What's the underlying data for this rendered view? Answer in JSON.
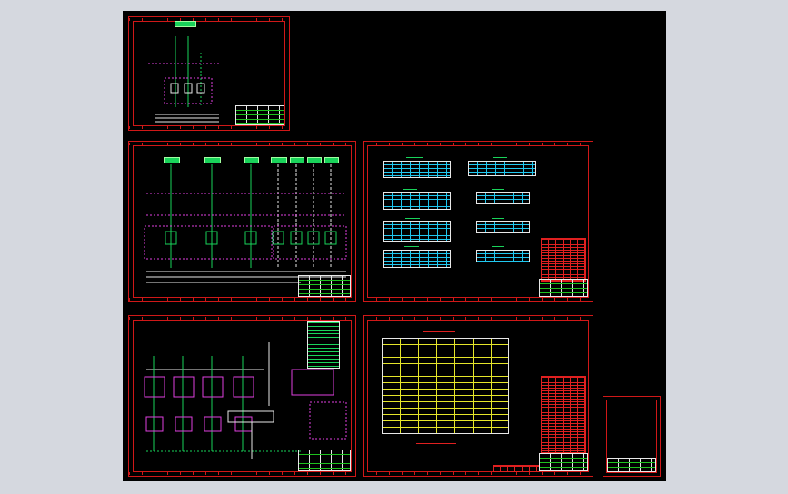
{
  "viewer": {
    "background_color": "#d5d8df",
    "canvas_color": "#000000",
    "frame_color": "#d01818",
    "wire_color": "#19d35a",
    "device_color": "#e040e0",
    "table_color": "#20c8f0",
    "text_color": "#e6e62a"
  },
  "drawing_sheets": [
    {
      "id": "sheet-1",
      "title_block": "title-block-1",
      "kind": "schematic-small"
    },
    {
      "id": "sheet-2",
      "title_block": "title-block-2",
      "kind": "schematic-wide"
    },
    {
      "id": "sheet-3",
      "title_block": "title-block-3",
      "kind": "parameter-tables"
    },
    {
      "id": "sheet-4",
      "title_block": "title-block-4",
      "kind": "schematic-mixed"
    },
    {
      "id": "sheet-5",
      "title_block": "title-block-5",
      "kind": "bill-of-materials"
    },
    {
      "id": "sheet-6",
      "title_block": "title-block-6",
      "kind": "blank-cover"
    }
  ],
  "icons": {
    "relay": "relay-icon",
    "breaker": "breaker-icon",
    "terminal": "terminal-icon"
  }
}
